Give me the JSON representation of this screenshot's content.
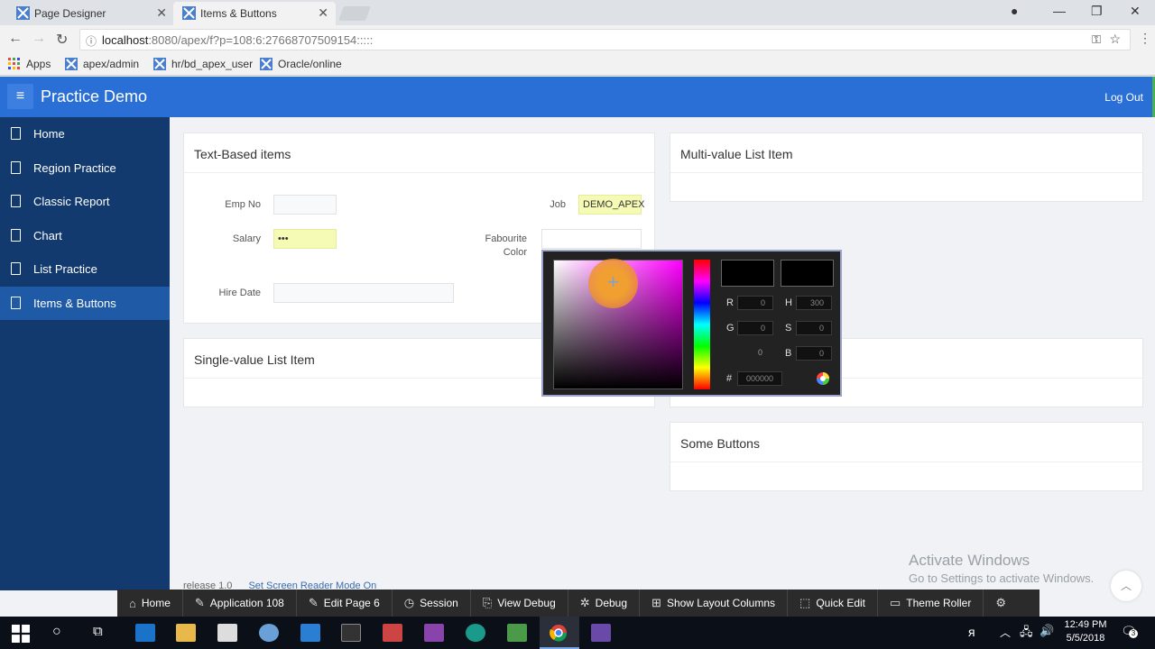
{
  "browser": {
    "tabs": [
      {
        "label": "Page Designer"
      },
      {
        "label": "Items & Buttons"
      }
    ],
    "url_host": "localhost",
    "url_rest": ":8080/apex/f?p=108:6:27668707509154:::::",
    "bookmarks": [
      {
        "label": "Apps"
      },
      {
        "label": "apex/admin"
      },
      {
        "label": "hr/bd_apex_user"
      },
      {
        "label": "Oracle/online"
      }
    ]
  },
  "app": {
    "title": "Practice Demo",
    "logout": "Log Out"
  },
  "sidebar": {
    "items": [
      {
        "label": "Home"
      },
      {
        "label": "Region Practice"
      },
      {
        "label": "Classic Report"
      },
      {
        "label": "Chart"
      },
      {
        "label": "List Practice"
      },
      {
        "label": "Items & Buttons"
      }
    ]
  },
  "regions": {
    "text_items": {
      "title": "Text-Based items",
      "emp_no_label": "Emp No",
      "emp_no_value": "",
      "job_label": "Job",
      "job_value": "DEMO_APEX",
      "salary_label": "Salary",
      "salary_value": "•••",
      "fav_color_label_1": "Fabourite",
      "fav_color_label_2": "Color",
      "hire_date_label": "Hire Date",
      "hire_date_value": ""
    },
    "single_value": {
      "title": "Single-value List Item"
    },
    "multi_value": {
      "title": "Multi-value List Item"
    },
    "buttons": {
      "title": "Some Buttons"
    }
  },
  "color_picker": {
    "r_label": "R",
    "r_value": "0",
    "g_label": "G",
    "g_value": "0",
    "b_label": "B",
    "b_value": "0",
    "h_label": "H",
    "h_value": "300",
    "s_label": "S",
    "s_value": "0",
    "extra_value": "0",
    "hex_label": "#",
    "hex_value": "000000",
    "current_color": "#000000",
    "hue_color": "#ff00ff"
  },
  "footer": {
    "release": "release 1.0",
    "screen_reader": "Set Screen Reader Mode On"
  },
  "watermark": {
    "line1": "Activate Windows",
    "line2": "Go to Settings to activate Windows."
  },
  "devbar": {
    "items": [
      {
        "label": "Home"
      },
      {
        "label": "Application 108"
      },
      {
        "label": "Edit Page 6"
      },
      {
        "label": "Session"
      },
      {
        "label": "View Debug"
      },
      {
        "label": "Debug"
      },
      {
        "label": "Show Layout Columns"
      },
      {
        "label": "Quick Edit"
      },
      {
        "label": "Theme Roller"
      }
    ]
  },
  "taskbar": {
    "time": "12:49 PM",
    "date": "5/5/2018",
    "notif_count": "3"
  }
}
